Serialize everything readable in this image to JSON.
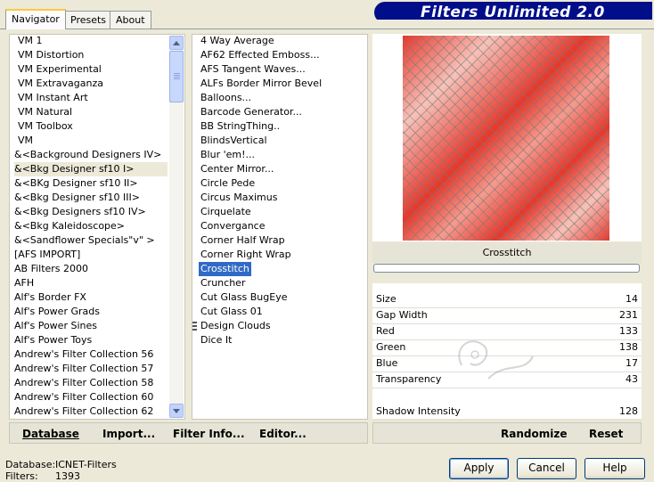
{
  "app": {
    "title": "Filters Unlimited 2.0"
  },
  "tabs": [
    {
      "label": "Navigator",
      "active": true
    },
    {
      "label": "Presets",
      "active": false
    },
    {
      "label": "About",
      "active": false
    }
  ],
  "categories": [
    "VM 1",
    "VM Distortion",
    "VM Experimental",
    "VM Extravaganza",
    "VM Instant Art",
    "VM Natural",
    "VM Toolbox",
    "VM",
    "&<Background Designers IV>",
    "&<Bkg Designer sf10 I>",
    "&<BKg Designer sf10 II>",
    "&<Bkg Designer sf10 III>",
    "&<Bkg Designers sf10 IV>",
    "&<Bkg Kaleidoscope>",
    "&<Sandflower Specials\"v\" >",
    "[AFS IMPORT]",
    "AB Filters 2000",
    "AFH",
    "Alf's Border FX",
    "Alf's Power Grads",
    "Alf's Power Sines",
    "Alf's Power Toys",
    "Andrew's Filter Collection 56",
    "Andrew's Filter Collection 57",
    "Andrew's Filter Collection 58",
    "Andrew's Filter Collection 60",
    "Andrew's Filter Collection 62"
  ],
  "selected_category": "&<Bkg Designer sf10 I>",
  "filters": [
    "4 Way Average",
    "AF62 Effected Emboss...",
    "AFS Tangent Waves...",
    "ALFs Border Mirror Bevel",
    "Balloons...",
    "Barcode Generator...",
    "BB StringThing..",
    "BlindsVertical",
    "Blur 'em!...",
    "Center Mirror...",
    "Circle Pede",
    "Circus Maximus",
    "Cirquelate",
    "Convergance",
    "Corner Half Wrap",
    "Corner Right Wrap",
    "Crosstitch",
    "Cruncher",
    "Cut Glass  BugEye",
    "Cut Glass 01",
    "Design Clouds",
    "Dice It"
  ],
  "selected_filter": "Crosstitch",
  "preview": {
    "filter_name": "Crosstitch"
  },
  "params": [
    {
      "label": "Size",
      "value": "14"
    },
    {
      "label": "Gap Width",
      "value": "231"
    },
    {
      "label": "Red",
      "value": "133"
    },
    {
      "label": "Green",
      "value": "138"
    },
    {
      "label": "Blue",
      "value": "17"
    },
    {
      "label": "Transparency",
      "value": "43"
    },
    {
      "label": "Shadow Intensity",
      "value": "128"
    }
  ],
  "toolbar": {
    "database": "Database",
    "import": "Import...",
    "filter_info": "Filter Info...",
    "editor": "Editor...",
    "randomize": "Randomize",
    "reset": "Reset"
  },
  "status": {
    "database_label": "Database:",
    "database_value": "ICNET-Filters",
    "filters_label": "Filters:",
    "filters_value": "1393"
  },
  "buttons": {
    "apply": "Apply",
    "cancel": "Cancel",
    "help": "Help"
  },
  "colors": {
    "banner": "#000e8a",
    "selection": "#316ac5",
    "preview_red": "#e8362a"
  }
}
